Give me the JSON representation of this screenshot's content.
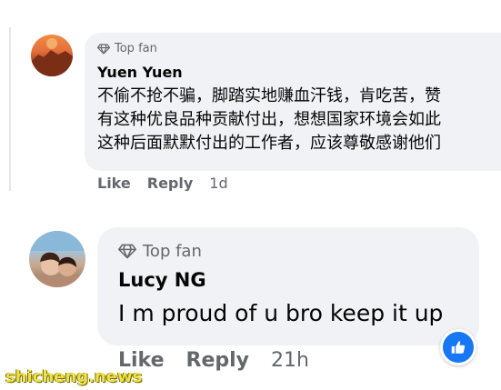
{
  "comments": [
    {
      "badge": "Top fan",
      "name": "Yuen Yuen",
      "lines": [
        "不偷不抢不骗，脚踏实地赚血汗钱，肯吃苦，赞",
        "有这种优良品种贡献付出，想想国家环境会如此",
        "这种后面默默付出的工作者，应该尊敬感谢他们"
      ],
      "like_label": "Like",
      "reply_label": "Reply",
      "time": "1d"
    },
    {
      "badge": "Top fan",
      "name": "Lucy NG",
      "text": "I m proud of u bro keep it up",
      "like_label": "Like",
      "reply_label": "Reply",
      "time": "21h",
      "reaction_icon": "thumbs-up-icon"
    }
  ],
  "watermark": "shicheng.news",
  "colors": {
    "bubble": "#f0f2f5",
    "secondary_text": "#65676b",
    "like_blue": "#1877f2"
  }
}
